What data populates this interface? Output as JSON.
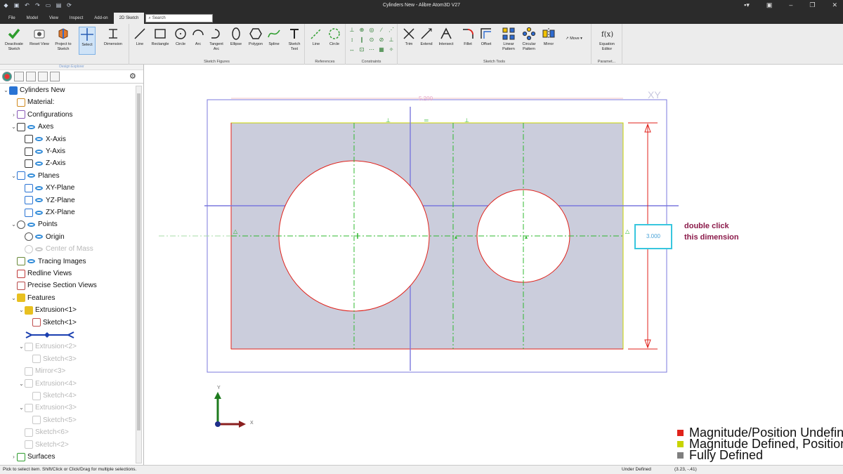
{
  "window": {
    "title": "Cylinders New - Alibre Atom3D V27"
  },
  "menu": {
    "tabs": [
      "File",
      "Model",
      "View",
      "Inspect",
      "Add-on",
      "2D Sketch"
    ],
    "search_placeholder": "Search"
  },
  "ribbon": {
    "deactivate": "Deactivate Sketch",
    "reset_view": "Reset View",
    "project": "Project to Sketch",
    "select": "Select",
    "dimension": "Dimension",
    "line": "Line",
    "rectangle": "Rectangle",
    "circle": "Circle",
    "arc": "Arc",
    "tangent_arc": "Tangent Arc",
    "ellipse": "Ellipse",
    "polygon": "Polygon",
    "spline": "Spline",
    "sketch_text": "Sketch Text",
    "ref_line": "Line",
    "ref_circle": "Circle",
    "trim": "Trim",
    "extend": "Extend",
    "intersect": "Intersect",
    "fillet": "Fillet",
    "offset": "Offset",
    "linear_pattern": "Linear Pattern",
    "circular_pattern": "Circular Pattern",
    "mirror": "Mirror",
    "move": "Move",
    "equation_editor": "Equation Editor",
    "groups": {
      "figures": "Sketch Figures",
      "references": "References",
      "constraints": "Constraints",
      "tools": "Sketch Tools",
      "param": "Paramet..."
    }
  },
  "panel": {
    "title": "Design Explorer",
    "tree": [
      {
        "label": "Cylinders New",
        "level": 0,
        "twisty": "v",
        "icon": "part",
        "eye": false,
        "dim": false
      },
      {
        "label": "Material:",
        "level": 1,
        "twisty": "",
        "icon": "material",
        "eye": false,
        "dim": false
      },
      {
        "label": "Configurations",
        "level": 1,
        "twisty": ">",
        "icon": "config",
        "eye": false,
        "dim": false
      },
      {
        "label": "Axes",
        "level": 1,
        "twisty": "v",
        "icon": "axis",
        "eye": true,
        "dim": false
      },
      {
        "label": "X-Axis",
        "level": 2,
        "twisty": "",
        "icon": "axis",
        "eye": true,
        "dim": false
      },
      {
        "label": "Y-Axis",
        "level": 2,
        "twisty": "",
        "icon": "axis",
        "eye": true,
        "dim": false
      },
      {
        "label": "Z-Axis",
        "level": 2,
        "twisty": "",
        "icon": "axis",
        "eye": true,
        "dim": false
      },
      {
        "label": "Planes",
        "level": 1,
        "twisty": "v",
        "icon": "plane",
        "eye": true,
        "dim": false
      },
      {
        "label": "XY-Plane",
        "level": 2,
        "twisty": "",
        "icon": "plane",
        "eye": true,
        "dim": false
      },
      {
        "label": "YZ-Plane",
        "level": 2,
        "twisty": "",
        "icon": "plane",
        "eye": true,
        "dim": false
      },
      {
        "label": "ZX-Plane",
        "level": 2,
        "twisty": "",
        "icon": "plane",
        "eye": true,
        "dim": false
      },
      {
        "label": "Points",
        "level": 1,
        "twisty": "v",
        "icon": "point",
        "eye": true,
        "dim": false
      },
      {
        "label": "Origin",
        "level": 2,
        "twisty": "",
        "icon": "point",
        "eye": true,
        "dim": false
      },
      {
        "label": "Center of Mass",
        "level": 2,
        "twisty": "",
        "icon": "com",
        "eye": true,
        "dim": true
      },
      {
        "label": "Tracing Images",
        "level": 1,
        "twisty": "",
        "icon": "image",
        "eye": true,
        "dim": false
      },
      {
        "label": "Redline Views",
        "level": 1,
        "twisty": "",
        "icon": "redline",
        "eye": false,
        "dim": false
      },
      {
        "label": "Precise Section Views",
        "level": 1,
        "twisty": "",
        "icon": "section",
        "eye": false,
        "dim": false
      },
      {
        "label": "Features",
        "level": 1,
        "twisty": "v",
        "icon": "features",
        "eye": false,
        "dim": false
      },
      {
        "label": "Extrusion<1>",
        "level": 2,
        "twisty": "v",
        "icon": "extrude",
        "eye": false,
        "dim": false
      },
      {
        "label": "Sketch<1>",
        "level": 3,
        "twisty": "",
        "icon": "sketch",
        "eye": false,
        "dim": false
      },
      {
        "label": "",
        "level": 2,
        "twisty": "",
        "icon": "rollback",
        "eye": false,
        "dim": false
      },
      {
        "label": "Extrusion<2>",
        "level": 2,
        "twisty": "v",
        "icon": "extrude2",
        "eye": false,
        "dim": true
      },
      {
        "label": "Sketch<3>",
        "level": 3,
        "twisty": "",
        "icon": "sketch",
        "eye": false,
        "dim": true
      },
      {
        "label": "Mirror<3>",
        "level": 2,
        "twisty": "",
        "icon": "mirror",
        "eye": false,
        "dim": true
      },
      {
        "label": "Extrusion<4>",
        "level": 2,
        "twisty": "v",
        "icon": "extrude2",
        "eye": false,
        "dim": true
      },
      {
        "label": "Sketch<4>",
        "level": 3,
        "twisty": "",
        "icon": "sketch",
        "eye": false,
        "dim": true
      },
      {
        "label": "Extrusion<3>",
        "level": 2,
        "twisty": "v",
        "icon": "extrude2",
        "eye": false,
        "dim": true
      },
      {
        "label": "Sketch<5>",
        "level": 3,
        "twisty": "",
        "icon": "sketch",
        "eye": false,
        "dim": true
      },
      {
        "label": "Sketch<6>",
        "level": 2,
        "twisty": "",
        "icon": "sketch",
        "eye": false,
        "dim": true
      },
      {
        "label": "Sketch<2>",
        "level": 2,
        "twisty": "",
        "icon": "sketch",
        "eye": false,
        "dim": true
      },
      {
        "label": "Surfaces",
        "level": 1,
        "twisty": ">",
        "icon": "surface",
        "eye": false,
        "dim": false
      }
    ]
  },
  "canvas": {
    "plane_label": "XY",
    "top_dimension": "5.200",
    "right_dimension": "3.000",
    "axis_x": "X",
    "axis_y": "Y",
    "annotation": [
      "double click",
      "this dimension"
    ]
  },
  "legend": [
    {
      "label": "Magnitude/Position Undefined",
      "color": "#e0221b"
    },
    {
      "label": "Magnitude Defined, Position Undefined",
      "color": "#c8d400"
    },
    {
      "label": "Fully Defined",
      "color": "#7f7f7f"
    }
  ],
  "status": {
    "hint": "Pick to select item. Shift/Click or Click/Drag for multiple selections.",
    "state": "Under Defined",
    "coords": "(3.23, -.41)"
  },
  "colors": {
    "sketch_fill": "#cbcddc",
    "boundary": "#c8d400",
    "circle": "#e0221b",
    "centerline": "#2fb82f",
    "plane": "#7b78dd",
    "dimension": "#e0221b",
    "highlight": "#38c6de"
  }
}
